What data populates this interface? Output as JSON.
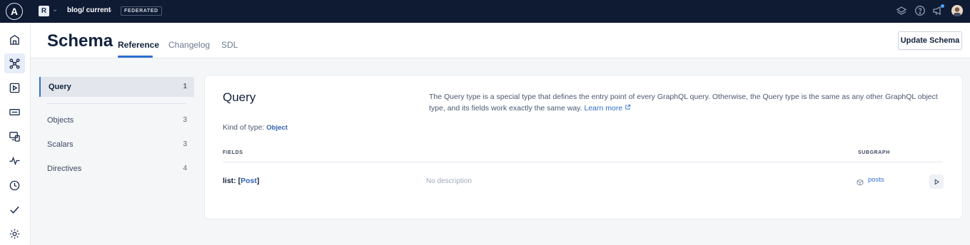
{
  "topbar": {
    "logo_letter": "A",
    "org_initial": "R",
    "graph_name": "blog/ current",
    "federated_badge": "FEDERATED"
  },
  "header": {
    "title": "Schema",
    "tabs": [
      {
        "label": "Reference",
        "active": true
      },
      {
        "label": "Changelog",
        "active": false
      },
      {
        "label": "SDL",
        "active": false
      }
    ],
    "update_button": "Update Schema"
  },
  "sidebar_list": [
    {
      "label": "Query",
      "count": "1",
      "selected": true
    },
    {
      "label": "Objects",
      "count": "3",
      "selected": false
    },
    {
      "label": "Scalars",
      "count": "3",
      "selected": false
    },
    {
      "label": "Directives",
      "count": "4",
      "selected": false
    }
  ],
  "type_detail": {
    "name": "Query",
    "description": "The Query type is a special type that defines the entry point of every GraphQL query. Otherwise, the Query type is the same as any other GraphQL object type, and its fields work exactly the same way.",
    "learn_more": "Learn more",
    "kind_label": "Kind of type:",
    "kind_value": "Object",
    "columns": {
      "fields": "FIELDS",
      "subgraph": "SUBGRAPH"
    },
    "fields": [
      {
        "name": "list:",
        "type_open": "[",
        "type": "Post",
        "type_close": "]",
        "description": "No description",
        "subgraph": "posts"
      }
    ]
  },
  "colors": {
    "accent": "#2f6fd1",
    "topbar": "#0f1b33"
  },
  "icons": [
    "home-icon",
    "graph-icon",
    "explorer-icon",
    "checks-icon",
    "clients-icon",
    "insights-icon",
    "history-icon",
    "launches-icon",
    "settings-icon"
  ]
}
